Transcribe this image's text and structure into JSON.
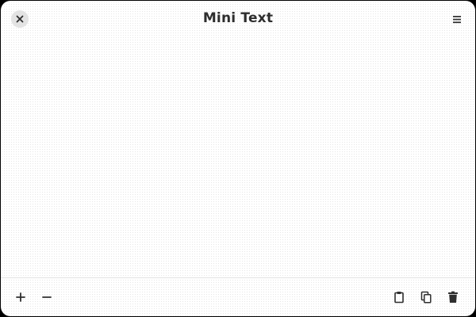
{
  "window": {
    "title": "Mini Text"
  },
  "header": {
    "close_icon": "close-icon",
    "menu_icon": "hamburger-menu-icon"
  },
  "editor": {
    "content": ""
  },
  "footer": {
    "left_buttons": [
      "zoom-in-plus-icon",
      "zoom-out-minus-icon"
    ],
    "right_buttons": [
      "paste-clipboard-icon",
      "copy-icon",
      "delete-trash-icon"
    ]
  },
  "colors": {
    "window_bg": "#ffffff",
    "icon": "#2e2e2e",
    "close_button_bg": "#e3e3e3"
  }
}
